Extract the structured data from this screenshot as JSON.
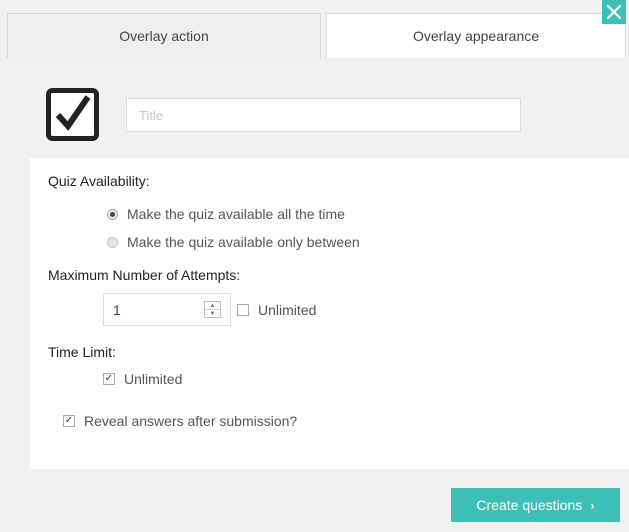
{
  "tabs": {
    "action_label": "Overlay action",
    "appearance_label": "Overlay appearance"
  },
  "title_field": {
    "placeholder": "Title",
    "value": ""
  },
  "quiz": {
    "availability_label": "Quiz Availability:",
    "availability_options": [
      {
        "label": "Make the quiz available all the time",
        "checked": true
      },
      {
        "label": "Make the quiz available only between",
        "checked": false
      }
    ],
    "attempts_label": "Maximum Number of Attempts:",
    "attempts_value": "1",
    "attempts_unlimited_label": "Unlimited",
    "attempts_unlimited_checked": false,
    "time_limit_label": "Time Limit:",
    "time_unlimited_label": "Unlimited",
    "time_unlimited_checked": true,
    "reveal_label": "Reveal answers after submission?",
    "reveal_checked": true
  },
  "footer": {
    "create_questions_label": "Create questions"
  },
  "colors": {
    "accent": "#3dbfb7",
    "panel": "#ffffff",
    "background": "#f1f1f1"
  }
}
